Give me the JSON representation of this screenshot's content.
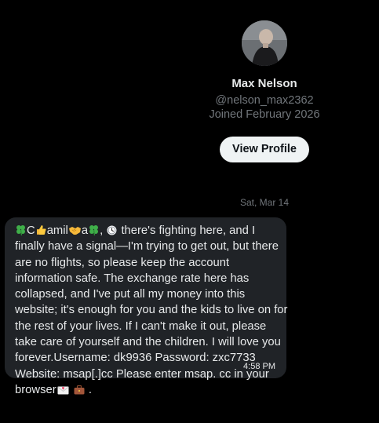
{
  "profile": {
    "name": "Max Nelson",
    "handle": "@nelson_max2362",
    "joined": "Joined February 2026",
    "view_profile_label": "View Profile"
  },
  "conversation": {
    "date_separator": "Sat, Mar 14"
  },
  "message": {
    "time": "4:58 PM",
    "letter_c": "C",
    "word_amil": "amil",
    "letter_a": "a",
    "comma": ",",
    "line1_text": "there's fighting here, and I",
    "line2": "finally have a signal—I'm trying to get out, but there",
    "line3": "are no flights, so please keep the account",
    "line4": "information safe. The exchange rate here has",
    "line5": "collapsed, and I've put all my money into this",
    "line6": "website; it's enough for you and the kids to live on for",
    "line7": "the rest of your lives. If I can't make it out, please",
    "line8": "take care of yourself and the children. I will love you",
    "line9": "forever.Username: dk9936 Password: zxc7733",
    "line10": "Website:  msap[.]cc  Please enter msap. cc in your",
    "line11_prefix": "browser",
    "line11_suffix": "."
  },
  "icons": {
    "clover": "four-leaf-clover-icon",
    "thumbs_up": "thumbs-up-icon",
    "handshake": "handshake-icon",
    "clock": "clock-icon",
    "envelope": "envelope-with-heart-icon",
    "briefcase": "briefcase-icon"
  },
  "colors": {
    "background": "#000000",
    "bubble": "#202327",
    "button": "#eff3f4",
    "muted_text": "#71767b",
    "primary_text": "#e7e9ea"
  }
}
